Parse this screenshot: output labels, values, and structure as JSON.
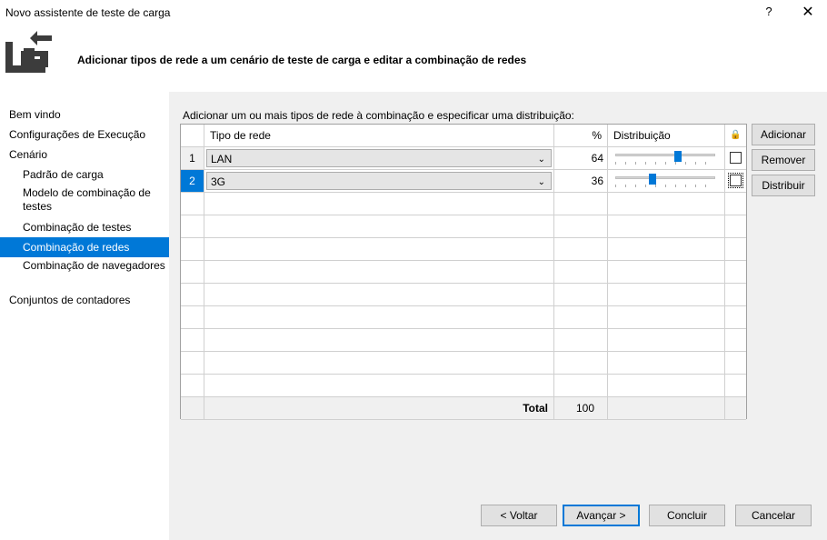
{
  "window": {
    "title": "Novo assistente de teste de carga",
    "help_label": "?",
    "close_label": "✕"
  },
  "header": {
    "text": "Adicionar tipos de rede a um cenário de teste de carga e editar a combinação de redes"
  },
  "nav": {
    "items": [
      {
        "label": "Bem vindo"
      },
      {
        "label": "Configurações de Execução"
      },
      {
        "label": "Cenário"
      },
      {
        "label": "Padrão de carga"
      },
      {
        "label": "Modelo de combinação de testes"
      },
      {
        "label": "Combinação de testes"
      },
      {
        "label": "Combinação de redes",
        "selected": true
      },
      {
        "label": "Combinação de navegadores"
      },
      {
        "label": "Conjuntos de contadores"
      }
    ]
  },
  "main": {
    "instruction": "Adicionar um ou mais tipos de rede à combinação e especificar uma distribuição:",
    "columns": {
      "type": "Tipo de rede",
      "percent": "%",
      "distribution": "Distribuição",
      "lock": "🔒"
    },
    "rows": [
      {
        "num": "1",
        "type": "LAN",
        "percent": "64",
        "slider_value": 64,
        "locked": false
      },
      {
        "num": "2",
        "type": "3G",
        "percent": "36",
        "slider_value": 36,
        "locked": false,
        "selected": true
      }
    ],
    "total_label": "Total",
    "total_value": "100",
    "side_buttons": {
      "add": "Adicionar",
      "remove": "Remover",
      "distribute": "Distribuir"
    }
  },
  "footer": {
    "back": "< Voltar",
    "next": "Avançar >",
    "finish": "Concluir",
    "cancel": "Cancelar"
  },
  "colors": {
    "accent": "#0078d7",
    "panel": "#f0f0f0"
  },
  "icons": {
    "header": "wizard-import-icon",
    "dropdown": "chevron-down-icon",
    "lock": "lock-icon"
  }
}
